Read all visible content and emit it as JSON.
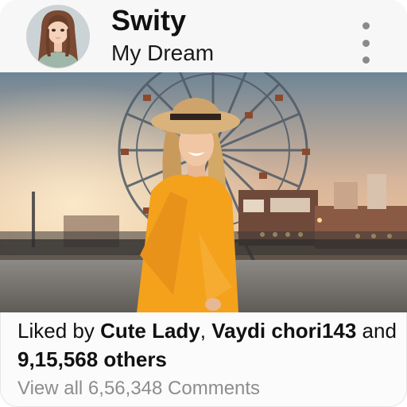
{
  "post": {
    "username": "Swity",
    "subtitle": "My Dream",
    "likes": {
      "prefix": "Liked by ",
      "user1": "Cute Lady",
      "separator": ", ",
      "user2": "Vaydi chori143",
      "conjunction": " and ",
      "count": "9,15,568 others"
    },
    "comments_link": "View all 6,56,348 Comments"
  },
  "icons": {
    "menu": "more-vertical-icon",
    "avatar": "avatar-illustration"
  },
  "colors": {
    "dress": "#f4a11c",
    "sky_top": "#6f8595",
    "sky_glow": "#f1c9a0"
  }
}
